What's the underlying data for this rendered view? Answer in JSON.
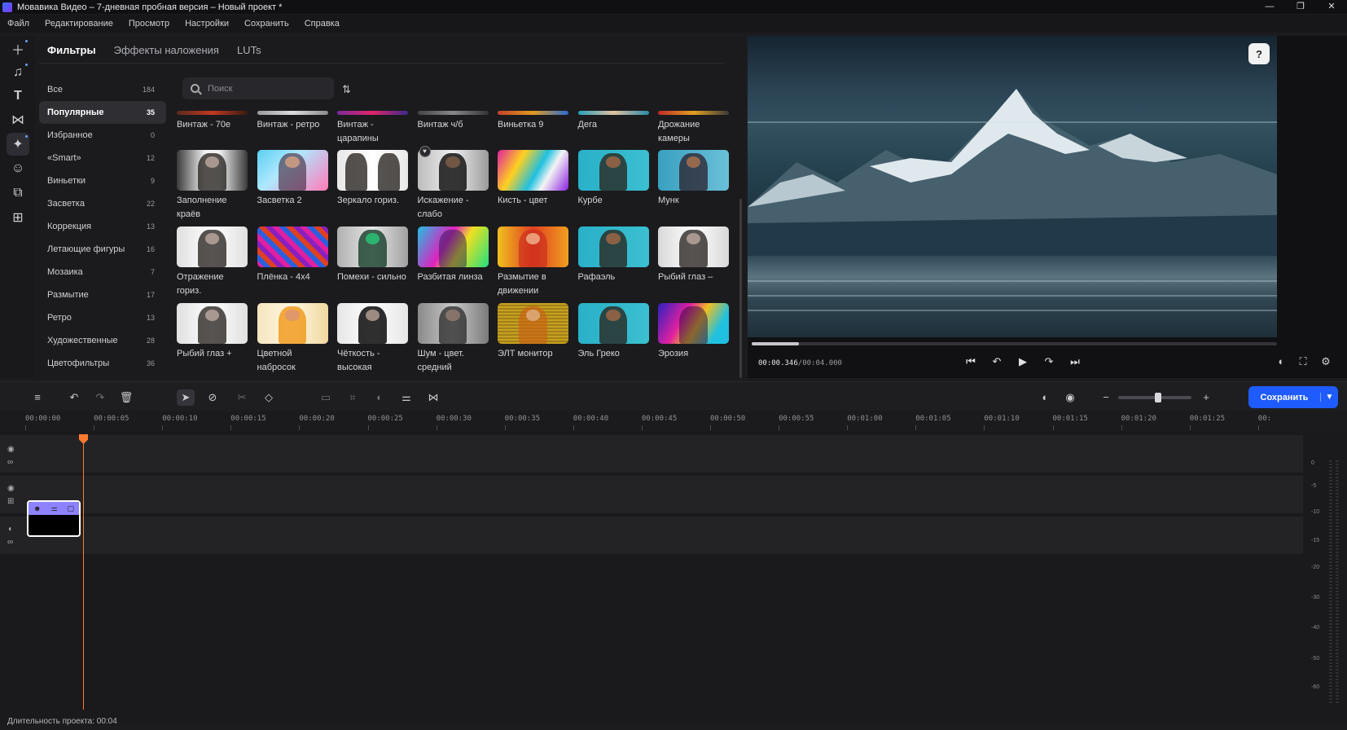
{
  "window": {
    "title": "Мовавика Видео – 7-дневная пробная версия – Новый проект *"
  },
  "menu": [
    "Файл",
    "Редактирование",
    "Просмотр",
    "Настройки",
    "Сохранить",
    "Справка"
  ],
  "tabs": [
    "Фильтры",
    "Эффекты наложения",
    "LUTs"
  ],
  "search": {
    "placeholder": "Поиск"
  },
  "categories": [
    {
      "label": "Все",
      "count": "184"
    },
    {
      "label": "Популярные",
      "count": "35"
    },
    {
      "label": "Избранное",
      "count": "0"
    },
    {
      "label": "«Smart»",
      "count": "12"
    },
    {
      "label": "Виньетки",
      "count": "9"
    },
    {
      "label": "Засветка",
      "count": "22"
    },
    {
      "label": "Коррекция",
      "count": "13"
    },
    {
      "label": "Летающие фигуры",
      "count": "16"
    },
    {
      "label": "Мозаика",
      "count": "7"
    },
    {
      "label": "Размытие",
      "count": "17"
    },
    {
      "label": "Ретро",
      "count": "13"
    },
    {
      "label": "Художественные",
      "count": "28"
    },
    {
      "label": "Цветофильтры",
      "count": "36"
    }
  ],
  "filters": {
    "row1": [
      "Винтаж - 70е",
      "Винтаж - ретро",
      "Винтаж - царапины",
      "Винтаж ч/б",
      "Виньетка 9",
      "Дега",
      "Дрожание камеры"
    ],
    "row2": [
      "Заполнение краёв",
      "Засветка 2",
      "Зеркало гориз.",
      "Искажение - слабо",
      "Кисть - цвет",
      "Курбе",
      "Мунк"
    ],
    "row3": [
      "Отражение гориз.",
      "Плёнка - 4x4",
      "Помехи - сильно",
      "Разбитая линза",
      "Размытие в движении",
      "Рафаэль",
      "Рыбий глаз –"
    ],
    "row4": [
      "Рыбий глаз +",
      "Цветной набросок",
      "Чёткость - высокая",
      "Шум - цвет. средний",
      "ЭЛТ монитор",
      "Эль Греко",
      "Эрозия"
    ]
  },
  "player": {
    "time_current": "00:00.346",
    "time_total": "/00:04.000",
    "progress": 0.09
  },
  "timeline": {
    "save_label": "Сохранить",
    "zoom_level": 0.55,
    "ruler": [
      "00:00:00",
      "00:00:05",
      "00:00:10",
      "00:00:15",
      "00:00:20",
      "00:00:25",
      "00:00:30",
      "00:00:35",
      "00:00:40",
      "00:00:45",
      "00:00:50",
      "00:00:55",
      "00:01:00",
      "00:01:05",
      "00:01:10",
      "00:01:15",
      "00:01:20",
      "00:01:25",
      "00:"
    ]
  },
  "meter_labels": [
    "0",
    "-5",
    "-10",
    "-15",
    "-20",
    "-30",
    "-40",
    "-50",
    "-60"
  ],
  "status": {
    "duration": "Длительность проекта: 00:04"
  }
}
